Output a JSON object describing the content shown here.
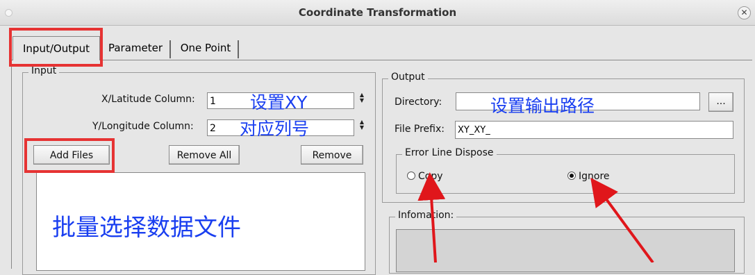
{
  "window": {
    "title": "Coordinate Transformation",
    "close_icon": "close-icon"
  },
  "tabs": [
    {
      "label": "Input/Output"
    },
    {
      "label": "Parameter"
    },
    {
      "label": "One Point"
    }
  ],
  "input": {
    "legend": "Input",
    "x_label": "X/Latitude Column:",
    "x_value": "1",
    "y_label": "Y/Longitude Column:",
    "y_value": "2",
    "add_files": "Add Files",
    "remove_all": "Remove All",
    "remove": "Remove"
  },
  "output": {
    "legend": "Output",
    "directory_label": "Directory:",
    "directory_value": "",
    "browse_label": "...",
    "prefix_label": "File Prefix:",
    "prefix_value": "XY_XY_",
    "error_legend": "Error Line Dispose",
    "copy_label": "Copy",
    "ignore_label": "Ignore",
    "info_legend": "Infomation:"
  },
  "annotations": {
    "xy_line1": "设置XY",
    "xy_line2": "对应列号",
    "output_path": "设置输出路径",
    "batch_files": "批量选择数据文件"
  },
  "colors": {
    "annotation_text": "#1a3ff0",
    "highlight_box": "#e63333",
    "arrow": "#e0161b"
  }
}
